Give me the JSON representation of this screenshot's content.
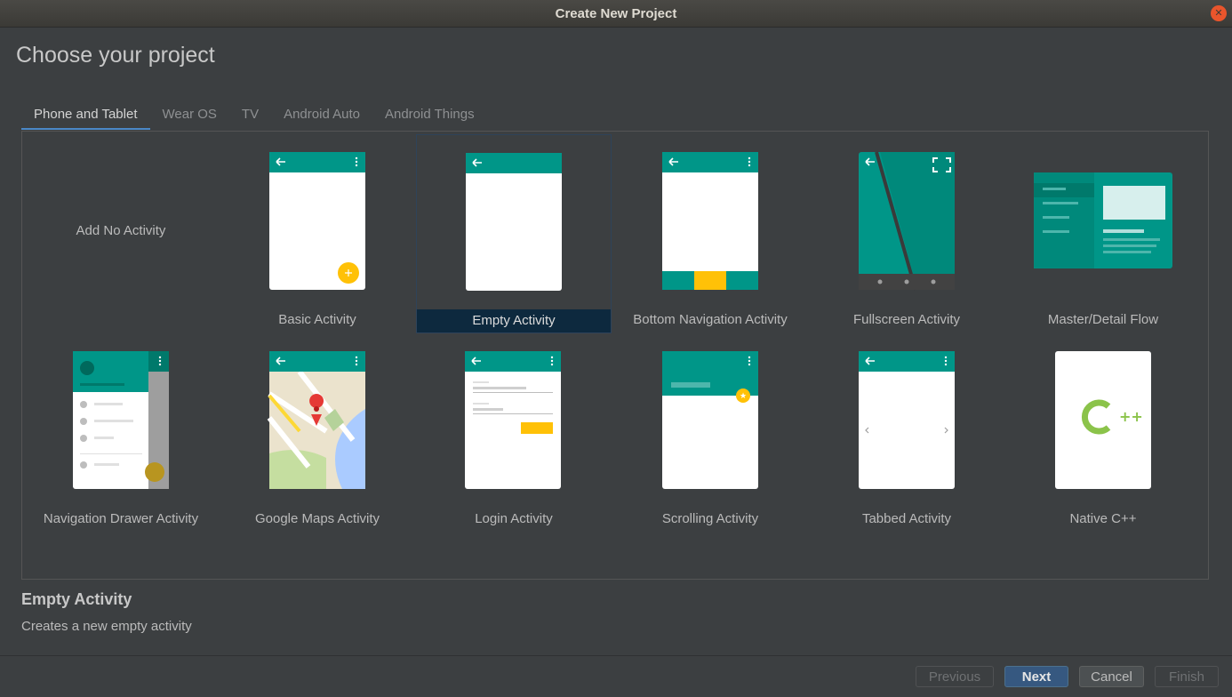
{
  "window": {
    "title": "Create New Project"
  },
  "page": {
    "heading": "Choose your project"
  },
  "tabs": [
    {
      "label": "Phone and Tablet"
    },
    {
      "label": "Wear OS"
    },
    {
      "label": "TV"
    },
    {
      "label": "Android Auto"
    },
    {
      "label": "Android Things"
    }
  ],
  "templates": [
    {
      "label": "Add No Activity"
    },
    {
      "label": "Basic Activity"
    },
    {
      "label": "Empty Activity"
    },
    {
      "label": "Bottom Navigation Activity"
    },
    {
      "label": "Fullscreen Activity"
    },
    {
      "label": "Master/Detail Flow"
    },
    {
      "label": "Navigation Drawer Activity"
    },
    {
      "label": "Google Maps Activity"
    },
    {
      "label": "Login Activity"
    },
    {
      "label": "Scrolling Activity"
    },
    {
      "label": "Tabbed Activity"
    },
    {
      "label": "Native C++"
    }
  ],
  "description": {
    "title": "Empty Activity",
    "text": "Creates a new empty activity"
  },
  "buttons": {
    "previous": "Previous",
    "next": "Next",
    "cancel": "Cancel",
    "finish": "Finish"
  },
  "icons": {
    "back": "←",
    "menu": "⋮",
    "plus": "+",
    "star": "★",
    "cpp": "++",
    "close": "✕",
    "prev_arrow": "‹",
    "next_arrow": "›"
  },
  "colors": {
    "teal": "#009688",
    "teal_dark": "#00796b",
    "amber": "#ffc107",
    "selected_bg": "#0d293e",
    "primary_button": "#365880",
    "cpp_green": "#8bc34a"
  }
}
